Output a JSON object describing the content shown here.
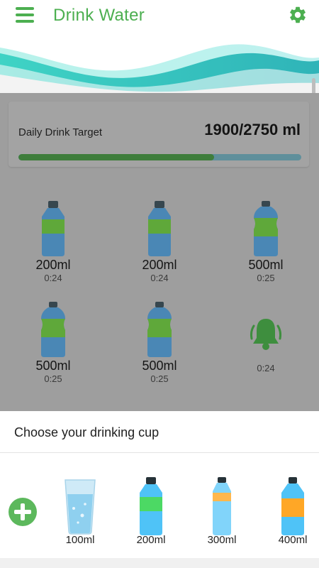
{
  "app_bar": {
    "title": "Drink Water",
    "menu_icon": "menu-icon",
    "settings_icon": "gear-icon"
  },
  "colors": {
    "accent": "#4caf50",
    "overlay": "#9e9e9e",
    "progress_fill": "#3e7d3b",
    "progress_track": "#5f8f9b"
  },
  "target": {
    "label": "Daily Drink Target",
    "value_text": "1900/2750 ml",
    "consumed_ml": 1900,
    "goal_ml": 2750
  },
  "drink_log": [
    {
      "amount": "200ml",
      "time": "0:24",
      "icon": "bottle-small-icon"
    },
    {
      "amount": "200ml",
      "time": "0:24",
      "icon": "bottle-small-icon"
    },
    {
      "amount": "500ml",
      "time": "0:25",
      "icon": "bottle-large-icon"
    },
    {
      "amount": "500ml",
      "time": "0:25",
      "icon": "bottle-large-icon"
    },
    {
      "amount": "500ml",
      "time": "0:25",
      "icon": "bottle-large-icon"
    },
    {
      "amount": "",
      "time": "0:24",
      "icon": "bell-icon"
    }
  ],
  "cup_chooser": {
    "title": "Choose your drinking cup",
    "add_icon": "add-cup-icon",
    "cups": [
      {
        "label": "100ml",
        "icon": "glass-icon"
      },
      {
        "label": "200ml",
        "icon": "bottle-green-icon"
      },
      {
        "label": "300ml",
        "icon": "bottle-tall-icon"
      },
      {
        "label": "400ml",
        "icon": "bottle-orange-icon"
      }
    ]
  }
}
